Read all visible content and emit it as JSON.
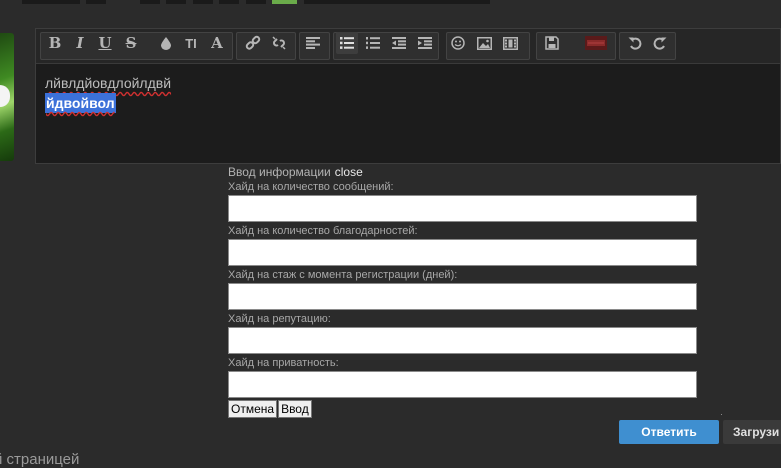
{
  "editor": {
    "content_line1": "лйвлдйовдлойлдвй",
    "content_line2": "йдвойвол",
    "toolbar": {
      "bold": "B",
      "italic": "I",
      "underline": "U",
      "strike": "S",
      "color": "color-drop-icon",
      "font_size": "TI",
      "font_family": "A",
      "link": "link-icon",
      "unlink": "unlink-icon",
      "align_left": "align-left-icon",
      "bullet_list": "bullet-list-icon",
      "numbered_list": "numbered-list-icon",
      "outdent": "outdent-icon",
      "indent": "indent-icon",
      "smiley": "smiley-icon",
      "image": "image-icon",
      "media": "media-icon",
      "save": "save-icon",
      "hide": "hide-icon",
      "undo": "undo-icon",
      "redo": "redo-icon"
    }
  },
  "form": {
    "title": "Ввод информации",
    "close_label": "close",
    "fields": [
      {
        "label": "Хайд на количество сообщений:",
        "value": ""
      },
      {
        "label": "Хайд на количество благодарностей:",
        "value": ""
      },
      {
        "label": "Хайд на стаж с момента регистрации (дней):",
        "value": ""
      },
      {
        "label": "Хайд на репутацию:",
        "value": ""
      },
      {
        "label": "Хайд на приватность:",
        "value": ""
      }
    ],
    "cancel_label": "Отмена",
    "submit_label": "Ввод"
  },
  "actions": {
    "reply_label": "Ответить",
    "upload_label": "Загрузи"
  },
  "footer_text": "й страницей",
  "colors": {
    "background": "#2b2b2b",
    "reply_button": "#3f8fd0",
    "selection": "#3c71d9",
    "accent_green": "#6aab4a"
  }
}
